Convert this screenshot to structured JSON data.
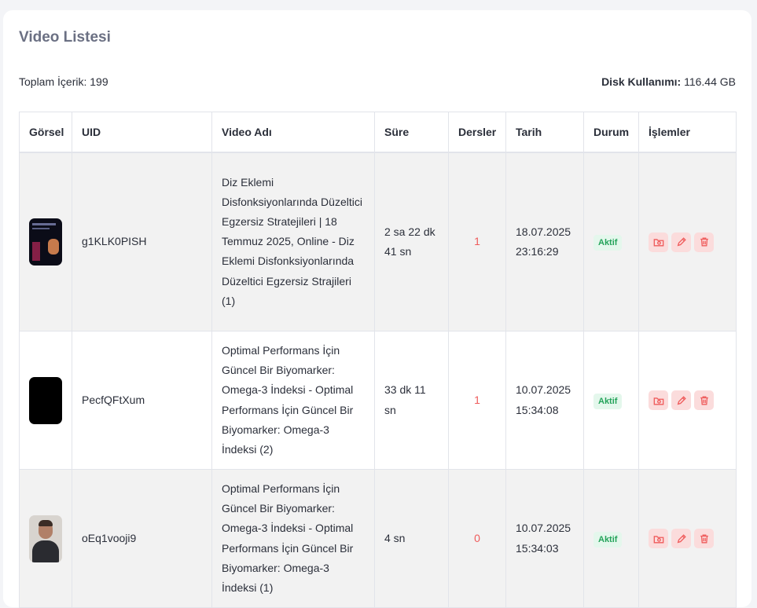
{
  "card": {
    "title": "Video Listesi"
  },
  "summary": {
    "total_label": "Toplam İçerik:",
    "total_value": "199",
    "disk_label": "Disk Kullanımı:",
    "disk_value": "116.44 GB"
  },
  "table": {
    "headers": [
      "Görsel",
      "UID",
      "Video Adı",
      "Süre",
      "Dersler",
      "Tarih",
      "Durum",
      "İşlemler"
    ],
    "rows": [
      {
        "uid": "g1KLK0PISH",
        "name": "Diz Eklemi Disfonksiyonlarında Düzeltici Egzersiz Stratejileri | 18 Temmuz 2025, Online - Diz Eklemi Disfonksiyonlarında Düzeltici Egzersiz Strajileri (1)",
        "duration": "2 sa 22 dk 41 sn",
        "lessons": "1",
        "date": "18.07.2025 23:16:29",
        "status": "Aktif"
      },
      {
        "uid": "PecfQFtXum",
        "name": "Optimal Performans İçin Güncel Bir Biyomarker: Omega-3 İndeksi - Optimal Performans İçin Güncel Bir Biyomarker: Omega-3 İndeksi (2)",
        "duration": "33 dk 11 sn",
        "lessons": "1",
        "date": "10.07.2025 15:34:08",
        "status": "Aktif"
      },
      {
        "uid": "oEq1vooji9",
        "name": "Optimal Performans İçin Güncel Bir Biyomarker: Omega-3 İndeksi - Optimal Performans İçin Güncel Bir Biyomarker: Omega-3 İndeksi (1)",
        "duration": "4 sn",
        "lessons": "0",
        "date": "10.07.2025 15:34:03",
        "status": "Aktif"
      }
    ]
  },
  "icons": {
    "folder_action": "folder-camera-icon",
    "edit_action": "pencil-icon",
    "delete_action": "trash-icon"
  },
  "colors": {
    "accent_red": "#ef5b5b",
    "status_green": "#24a35a",
    "status_bg": "#e4f7ec",
    "action_bg": "#fbdcdc"
  }
}
